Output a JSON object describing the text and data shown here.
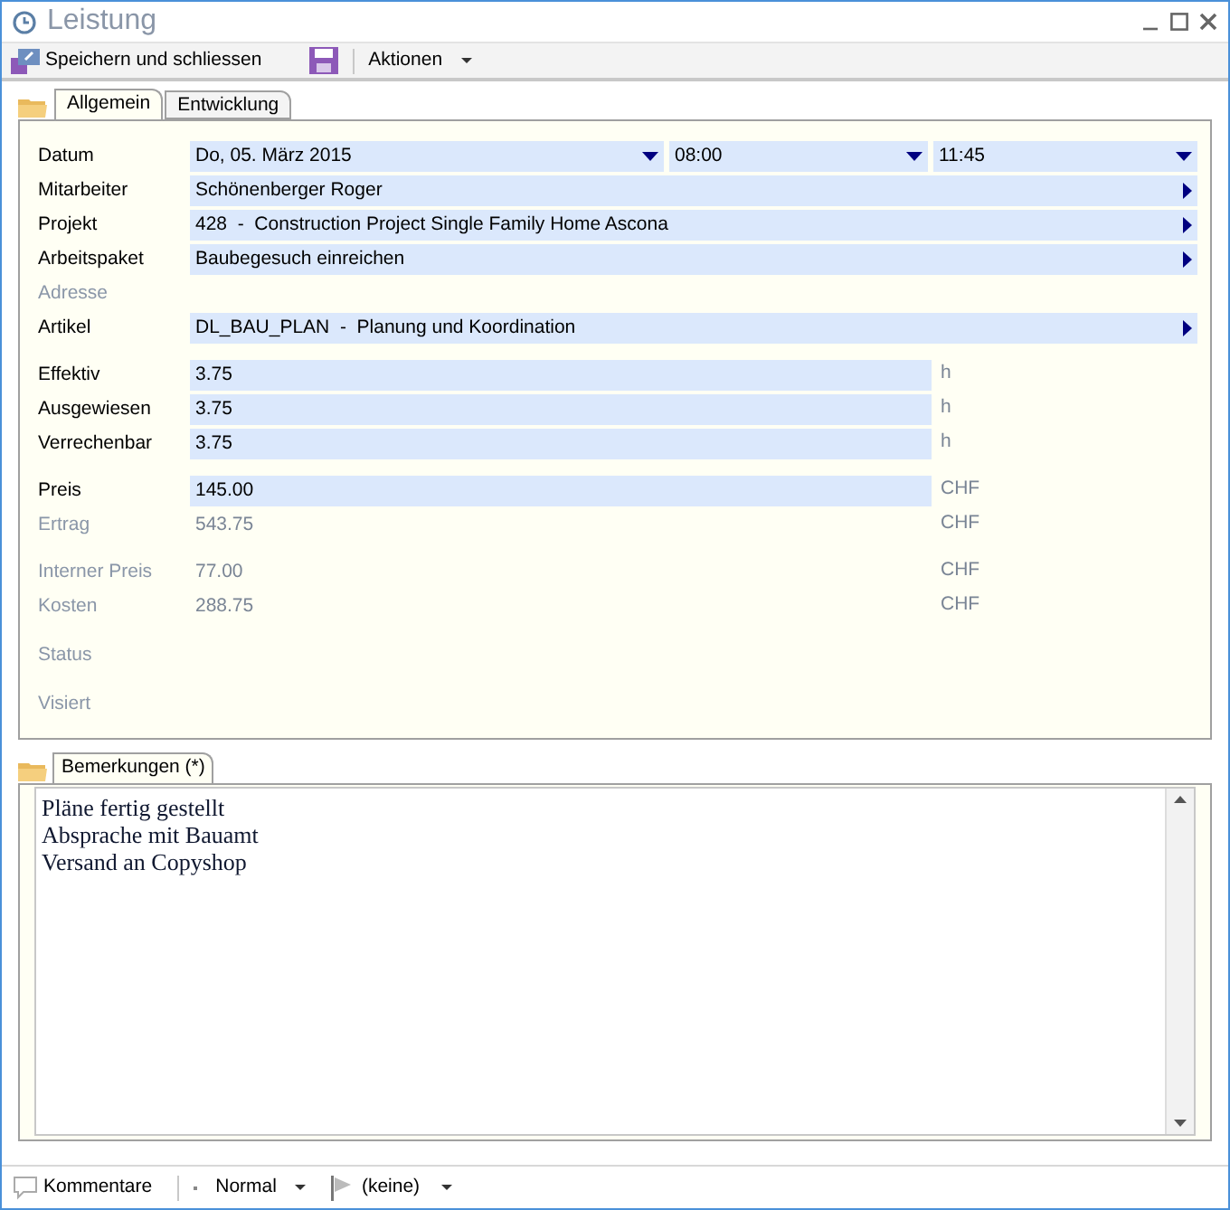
{
  "window": {
    "title": "Leistung"
  },
  "toolbar": {
    "save_close": "Speichern und schliessen",
    "actions": "Aktionen"
  },
  "tabs": [
    {
      "label": "Allgemein",
      "selected": true
    },
    {
      "label": "Entwicklung",
      "selected": false
    }
  ],
  "form": {
    "groups": [
      {
        "rows": [
          {
            "kind": "date",
            "label": "Datum",
            "disabled": false,
            "value": "Do, 05. März 2015",
            "time_from": "08:00",
            "time_to": "11:45"
          },
          {
            "kind": "lookup",
            "label": "Mitarbeiter",
            "disabled": false,
            "value": "Schönenberger Roger"
          },
          {
            "kind": "lookup",
            "label": "Projekt",
            "disabled": false,
            "value": "428  -  Construction Project Single Family Home Ascona"
          },
          {
            "kind": "lookup",
            "label": "Arbeitspaket",
            "disabled": false,
            "value": "Baubegesuch einreichen"
          },
          {
            "kind": "empty",
            "label": "Adresse",
            "disabled": true
          },
          {
            "kind": "lookup",
            "label": "Artikel",
            "disabled": false,
            "value": "DL_BAU_PLAN  -  Planung und Koordination"
          }
        ]
      },
      {
        "rows": [
          {
            "kind": "number",
            "label": "Effektiv",
            "disabled": false,
            "value": "3.75",
            "unit": "h"
          },
          {
            "kind": "number",
            "label": "Ausgewiesen",
            "disabled": false,
            "value": "3.75",
            "unit": "h"
          },
          {
            "kind": "number",
            "label": "Verrechenbar",
            "disabled": false,
            "value": "3.75",
            "unit": "h"
          }
        ]
      },
      {
        "rows": [
          {
            "kind": "number",
            "label": "Preis",
            "disabled": false,
            "value": "145.00",
            "unit": "CHF"
          },
          {
            "kind": "number",
            "label": "Ertrag",
            "disabled": true,
            "value": "543.75",
            "unit": "CHF"
          }
        ]
      },
      {
        "rows": [
          {
            "kind": "number",
            "label": "Interner Preis",
            "disabled": true,
            "value": "77.00",
            "unit": "CHF"
          },
          {
            "kind": "number",
            "label": "Kosten",
            "disabled": true,
            "value": "288.75",
            "unit": "CHF"
          }
        ]
      },
      {
        "rows": [
          {
            "kind": "empty",
            "label": "Status",
            "disabled": true
          }
        ]
      },
      {
        "rows": [
          {
            "kind": "empty",
            "label": "Visiert",
            "disabled": true
          }
        ]
      }
    ]
  },
  "remarks": {
    "tab": "Bemerkungen (*)",
    "lines": [
      "Pläne fertig gestellt",
      "Absprache mit Bauamt",
      "Versand an Copyshop"
    ]
  },
  "status_bar": {
    "comments": "Kommentare",
    "priority": "Normal",
    "flag": "(keine)"
  }
}
